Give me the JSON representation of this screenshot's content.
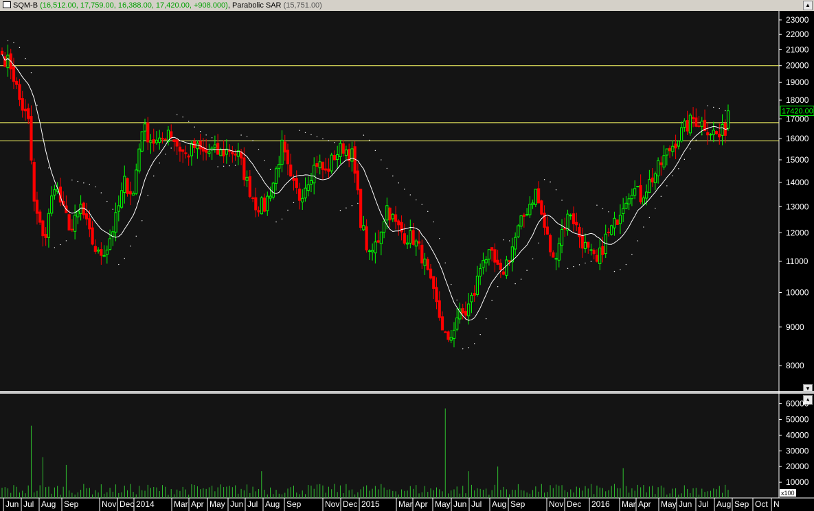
{
  "header": {
    "symbol": "SQM-B",
    "ohlc": "(16,512.00, 17,759.00, 16,388.00, 17,420.00, +908.000)",
    "indicator": "Parabolic SAR",
    "indicator_value": "(15,751.00)"
  },
  "colors": {
    "up": "#00ff00",
    "down": "#ff0000",
    "ma": "#ffffff",
    "sar": "#ffffff",
    "hline": "#ffff66",
    "axis": "#ffffff",
    "bg": "#141414",
    "last_label": "#00ff00"
  },
  "price_axis": {
    "ticks": [
      "23000",
      "22000",
      "21000",
      "20000",
      "19000",
      "18000",
      "17000",
      "16000",
      "15000",
      "14000",
      "13000",
      "12000",
      "11000",
      "10000",
      "9000",
      "8000"
    ],
    "scale": "log",
    "range": [
      7400,
      23600
    ],
    "last_label": "17420.00"
  },
  "volume_axis": {
    "ticks": [
      "60000",
      "50000",
      "40000",
      "30000",
      "20000",
      "10000"
    ],
    "multiplier_label": "x100",
    "range": [
      0,
      62000
    ]
  },
  "x_axis": {
    "labels": [
      "Jun",
      "Jul",
      "Aug",
      "Sep",
      "Nov",
      "Dec",
      "2014",
      "Mar",
      "Apr",
      "May",
      "Jun",
      "Jul",
      "Aug",
      "Sep",
      "Nov",
      "Dec",
      "2015",
      "Mar",
      "Apr",
      "May",
      "Jun",
      "Jul",
      "Aug",
      "Sep",
      "Nov",
      "Dec",
      "2016",
      "Mar",
      "Apr",
      "May",
      "Jun",
      "Jul",
      "Aug",
      "Sep",
      "Oct",
      "N"
    ]
  },
  "chart_data": {
    "type": "candlestick",
    "title": "SQM-B",
    "interval": "weekly",
    "horizontal_lines": [
      20000,
      16800,
      15900
    ],
    "anchors": [
      [
        0,
        20700
      ],
      [
        3,
        20000
      ],
      [
        6,
        18000
      ],
      [
        9,
        16800
      ],
      [
        11,
        13100
      ],
      [
        13,
        12200
      ],
      [
        15,
        11900
      ],
      [
        18,
        14000
      ],
      [
        21,
        12800
      ],
      [
        24,
        12100
      ],
      [
        27,
        13000
      ],
      [
        30,
        11900
      ],
      [
        33,
        11200
      ],
      [
        36,
        11500
      ],
      [
        39,
        12500
      ],
      [
        42,
        14000
      ],
      [
        45,
        13500
      ],
      [
        48,
        16600
      ],
      [
        51,
        16000
      ],
      [
        54,
        15700
      ],
      [
        57,
        16500
      ],
      [
        60,
        15700
      ],
      [
        63,
        15200
      ],
      [
        66,
        15600
      ],
      [
        69,
        15300
      ],
      [
        72,
        15400
      ],
      [
        75,
        15300
      ],
      [
        78,
        15500
      ],
      [
        81,
        15200
      ],
      [
        84,
        14000
      ],
      [
        87,
        13100
      ],
      [
        90,
        13000
      ],
      [
        93,
        14000
      ],
      [
        96,
        15600
      ],
      [
        99,
        14000
      ],
      [
        102,
        13400
      ],
      [
        105,
        14200
      ],
      [
        108,
        14900
      ],
      [
        111,
        14400
      ],
      [
        114,
        15200
      ],
      [
        117,
        15600
      ],
      [
        120,
        15200
      ],
      [
        123,
        12500
      ],
      [
        126,
        11100
      ],
      [
        129,
        11800
      ],
      [
        132,
        13000
      ],
      [
        135,
        12300
      ],
      [
        138,
        11900
      ],
      [
        141,
        11800
      ],
      [
        144,
        11200
      ],
      [
        147,
        10200
      ],
      [
        150,
        9300
      ],
      [
        153,
        8500
      ],
      [
        156,
        9300
      ],
      [
        159,
        9400
      ],
      [
        162,
        10000
      ],
      [
        165,
        11200
      ],
      [
        168,
        11100
      ],
      [
        171,
        10500
      ],
      [
        174,
        11200
      ],
      [
        177,
        12100
      ],
      [
        180,
        12900
      ],
      [
        183,
        13600
      ],
      [
        186,
        12200
      ],
      [
        189,
        11000
      ],
      [
        192,
        12100
      ],
      [
        195,
        12800
      ],
      [
        198,
        11900
      ],
      [
        201,
        11300
      ],
      [
        204,
        10900
      ],
      [
        207,
        11800
      ],
      [
        210,
        12300
      ],
      [
        213,
        13200
      ],
      [
        216,
        13800
      ],
      [
        219,
        13400
      ],
      [
        222,
        14000
      ],
      [
        225,
        14600
      ],
      [
        228,
        15300
      ],
      [
        231,
        15900
      ],
      [
        234,
        16500
      ],
      [
        237,
        17000
      ],
      [
        240,
        16800
      ],
      [
        243,
        16400
      ],
      [
        246,
        16100
      ],
      [
        248,
        16512
      ],
      [
        249,
        17420
      ]
    ],
    "volume_peaks": [
      {
        "week": 10,
        "value": 46000
      },
      {
        "week": 14,
        "value": 26000
      },
      {
        "week": 22,
        "value": 21000
      },
      {
        "week": 89,
        "value": 17000
      },
      {
        "week": 152,
        "value": 57000
      },
      {
        "week": 160,
        "value": 17000
      },
      {
        "week": 170,
        "value": 20000
      },
      {
        "week": 213,
        "value": 19000
      }
    ],
    "last_close": 17420
  }
}
